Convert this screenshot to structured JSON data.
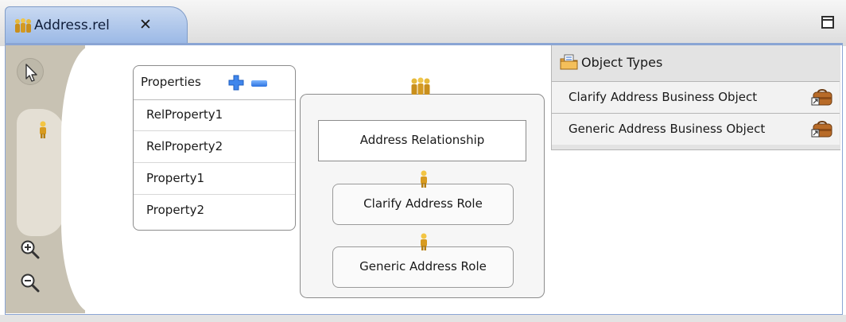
{
  "tab": {
    "title": "Address.rel",
    "close_symbol": "✕"
  },
  "properties": {
    "title": "Properties",
    "items": [
      "RelProperty1",
      "RelProperty2",
      "Property1",
      "Property2"
    ]
  },
  "relationship": {
    "name": "Address Relationship",
    "roles": [
      "Clarify Address Role",
      "Generic Address Role"
    ]
  },
  "object_types": {
    "title": "Object Types",
    "items": [
      "Clarify Address Business Object",
      "Generic Address Business Object"
    ]
  },
  "colors": {
    "tab_active": "#9cb9e6",
    "frame_border": "#8aa5d4",
    "palette": "#c8c2b3",
    "add_remove": "#2b72e0"
  },
  "icons": {
    "tab": "people-group-icon",
    "select": "arrow-pointer-icon",
    "role": "person-icon",
    "zoom_in": "zoom-in-icon",
    "zoom_out": "zoom-out-icon",
    "object_types": "folder-document-icon",
    "business_object": "briefcase-link-icon"
  }
}
